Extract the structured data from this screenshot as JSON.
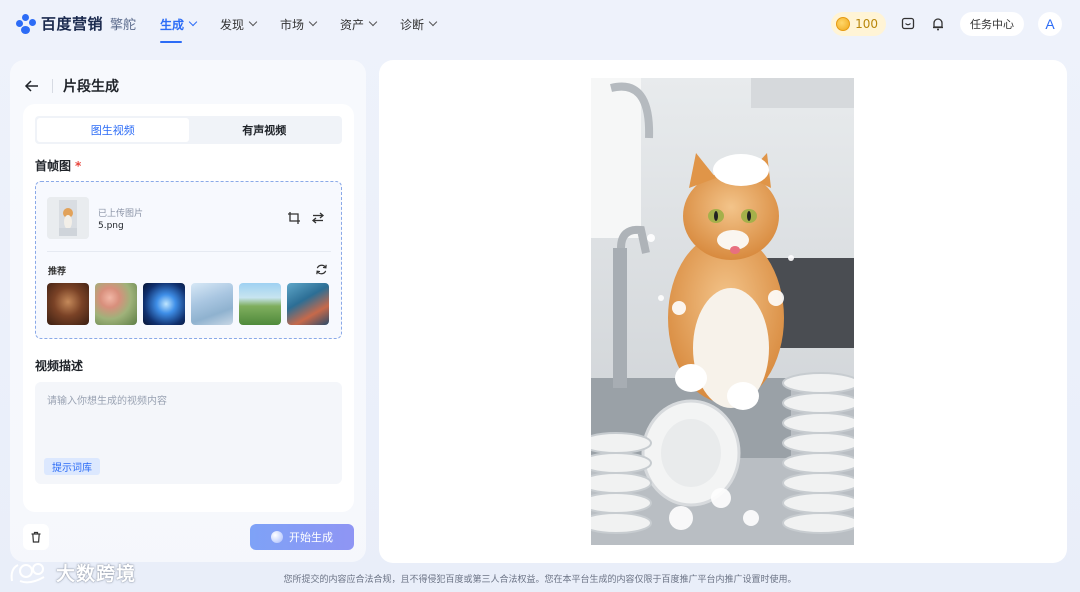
{
  "brand": {
    "name": "百度营销",
    "product": "擎舵"
  },
  "nav": {
    "items": [
      {
        "label": "生成",
        "active": true
      },
      {
        "label": "发现",
        "active": false
      },
      {
        "label": "市场",
        "active": false
      },
      {
        "label": "资产",
        "active": false
      },
      {
        "label": "诊断",
        "active": false
      }
    ]
  },
  "header": {
    "credits": "100",
    "task_center": "任务中心",
    "avatar_initial": "A"
  },
  "panel": {
    "title": "片段生成",
    "tabs": [
      {
        "label": "图生视频",
        "active": true
      },
      {
        "label": "有声视频",
        "active": false
      }
    ],
    "first_frame_label": "首帧图",
    "required_mark": "*",
    "upload": {
      "hint": "已上传图片",
      "filename": "5.png"
    },
    "recommend_label": "推荐",
    "description_label": "视频描述",
    "description": {
      "value": "",
      "placeholder": "请输入你想生成的视频内容"
    },
    "prompt_library": "提示词库",
    "generate_button": "开始生成"
  },
  "footer": {
    "note": "您所提交的内容应合法合规，且不得侵犯百度或第三人合法权益。您在本平台生成的内容仅限于百度推广平台内推广设置时使用。"
  },
  "watermark": {
    "text": "大数跨境"
  },
  "colors": {
    "accent": "#2c6cf6",
    "required": "#e8453c",
    "coin": "#f0a91c"
  }
}
